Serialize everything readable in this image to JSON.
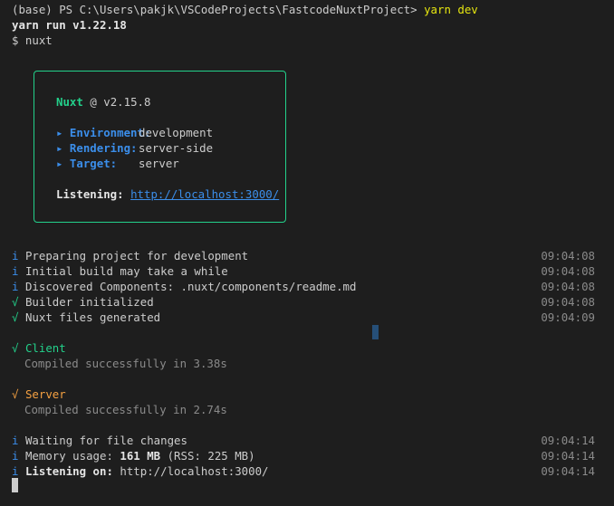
{
  "prompt": {
    "prefix": "(base) PS C:\\Users\\pakjk\\VSCodeProjects\\FastcodeNuxtProject> ",
    "command": "yarn dev"
  },
  "yarn_version": "yarn run v1.22.18",
  "script_line": "$ nuxt",
  "banner": {
    "name": "Nuxt",
    "version": "@ v2.15.8",
    "rows": [
      {
        "label": "▸ Environment:",
        "value": "development"
      },
      {
        "label": "▸ Rendering:",
        "value": "server-side"
      },
      {
        "label": "▸ Target:",
        "value": "server"
      }
    ],
    "listening_label": "Listening:",
    "listening_url": "http://localhost:3000/"
  },
  "log": [
    {
      "icon": "i",
      "text": "Preparing project for development",
      "time": "09:04:08"
    },
    {
      "icon": "i",
      "text": "Initial build may take a while",
      "time": "09:04:08"
    },
    {
      "icon": "i",
      "text": "Discovered Components: .nuxt/components/readme.md",
      "time": "09:04:08"
    },
    {
      "icon": "√",
      "text": "Builder initialized",
      "time": "09:04:08"
    },
    {
      "icon": "√",
      "text": "Nuxt files generated",
      "time": "09:04:09"
    }
  ],
  "client": {
    "icon": "√",
    "label": "Client",
    "status": "Compiled successfully in 3.38s"
  },
  "server": {
    "icon": "√",
    "label": "Server",
    "status": "Compiled successfully in 2.74s"
  },
  "watch_log": [
    {
      "icon": "i",
      "text": "Waiting for file changes",
      "time": "09:04:14"
    },
    {
      "icon": "i",
      "prefix": "Memory usage: ",
      "bold": "161 MB",
      "suffix": " (RSS: 225 MB)",
      "time": "09:04:14"
    },
    {
      "icon": "i",
      "prefix": "",
      "bold": "Listening on:",
      "suffix": " http://localhost:3000/",
      "time": "09:04:14"
    }
  ],
  "colors": {
    "background": "#1e1e1e",
    "info": "#3b8eea",
    "success": "#23d18b",
    "warning": "#f5a142",
    "prompt_command": "#e5e510"
  }
}
